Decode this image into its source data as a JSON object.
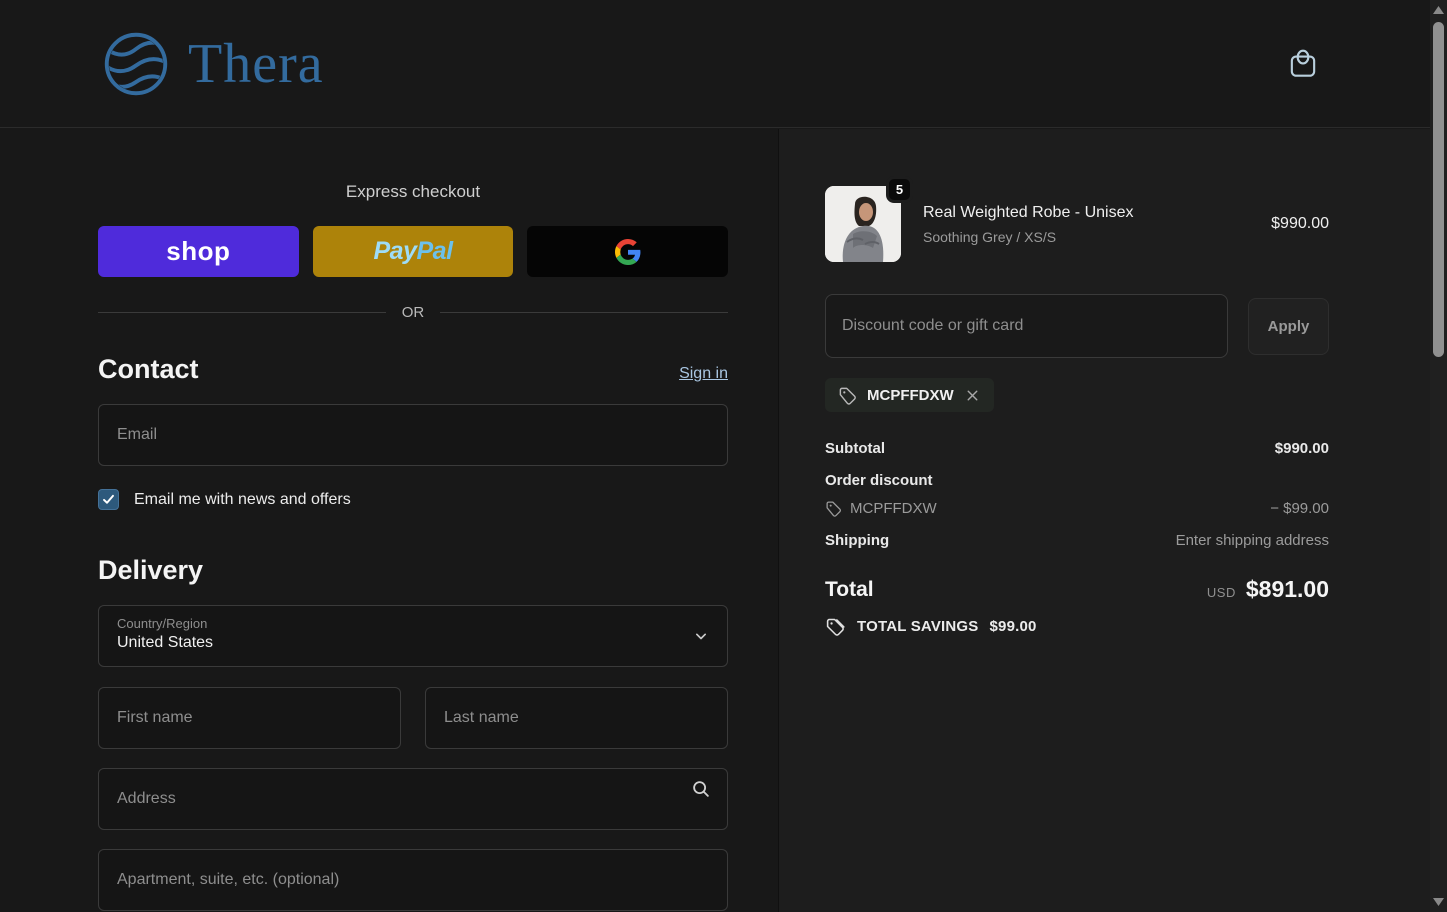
{
  "header": {
    "brand": "Thera",
    "cart_icon": "shopping-bag"
  },
  "express": {
    "label": "Express checkout",
    "shop_label": "shop",
    "paypal_first": "Pay",
    "paypal_second": "Pal",
    "google_icon": "google-g",
    "or_label": "OR"
  },
  "contact": {
    "title": "Contact",
    "signin_label": "Sign in",
    "email_placeholder": "Email",
    "newsletter_label": "Email me with news and offers",
    "newsletter_checked": true
  },
  "delivery": {
    "title": "Delivery",
    "country_label": "Country/Region",
    "country_value": "United States",
    "first_name_placeholder": "First name",
    "last_name_placeholder": "Last name",
    "address_placeholder": "Address",
    "apartment_placeholder": "Apartment, suite, etc. (optional)"
  },
  "summary": {
    "product": {
      "name": "Real Weighted Robe - Unisex",
      "variant": "Soothing Grey / XS/S",
      "quantity": "5",
      "price": "$990.00"
    },
    "discount_placeholder": "Discount code or gift card",
    "apply_label": "Apply",
    "applied_code": "MCPFFDXW",
    "subtotal_label": "Subtotal",
    "subtotal_value": "$990.00",
    "discount_label": "Order discount",
    "discount_code": "MCPFFDXW",
    "discount_value": "− $99.00",
    "shipping_label": "Shipping",
    "shipping_value": "Enter shipping address",
    "total_label": "Total",
    "currency": "USD",
    "total_value": "$891.00",
    "savings_label": "TOTAL SAVINGS",
    "savings_value": "$99.00"
  },
  "colors": {
    "brand_blue": "#336b9e",
    "shop_purple": "#4f2bdb",
    "paypal_gold": "#ad830a",
    "google_black": "#050505",
    "checkbox_blue": "#2d597c",
    "left_bg": "#181818",
    "right_bg": "#1d1d1d"
  }
}
